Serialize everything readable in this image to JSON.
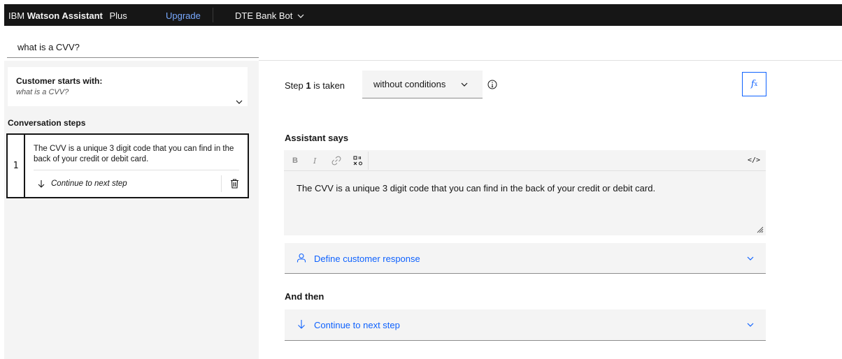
{
  "header": {
    "brand_prefix": "IBM",
    "brand_product": "Watson Assistant",
    "plan": "Plus",
    "upgrade_label": "Upgrade",
    "bot_name": "DTE Bank Bot"
  },
  "action": {
    "title": "what is a CVV?"
  },
  "sidebar": {
    "starts_label": "Customer starts with:",
    "starts_value": "what is a CVV?",
    "steps_heading": "Conversation steps",
    "steps": [
      {
        "number": "1",
        "text": "The CVV is a unique 3 digit code that you can find in the back of your credit or debit card.",
        "next_label": "Continue to next step"
      }
    ]
  },
  "step_editor": {
    "step_prefix": "Step",
    "step_number": "1",
    "step_suffix": "is taken",
    "condition_value": "without conditions",
    "fx_label": "f",
    "fx_sub": "x",
    "assistant_heading": "Assistant says",
    "toolbar": {
      "bold": "B",
      "italic": "I",
      "code": "</>"
    },
    "message": "The CVV is a unique 3 digit code that you can find in the back of your credit or debit card.",
    "define_response_label": "Define customer response",
    "and_then_heading": "And then",
    "and_then_value": "Continue to next step"
  },
  "colors": {
    "topbar": "#161616",
    "accent": "#0f62fe",
    "upgrade_link": "#78a9ff",
    "panel_bg": "#f4f4f4"
  }
}
